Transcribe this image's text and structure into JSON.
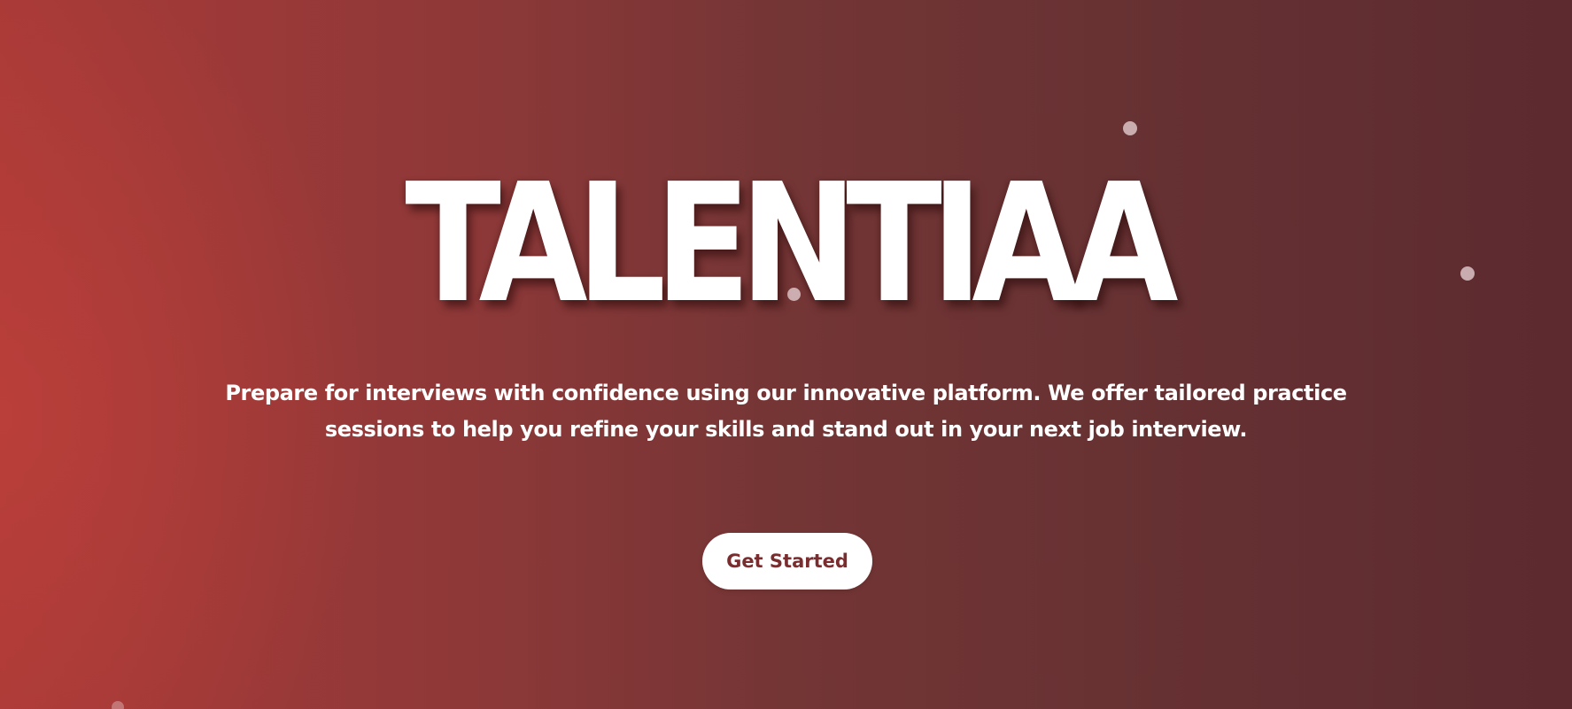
{
  "hero": {
    "title": "TALENTIAA",
    "tagline": "Prepare for interviews with confidence using our innovative platform. We offer tailored practice sessions to help you refine your skills and stand out in your next job interview.",
    "cta_label": "Get Started"
  },
  "colors": {
    "background_start": "#a93a37",
    "background_end": "#5c2a2f",
    "title_text": "#ffffff",
    "cta_background": "#ffffff",
    "cta_text": "#7a2d2f"
  }
}
